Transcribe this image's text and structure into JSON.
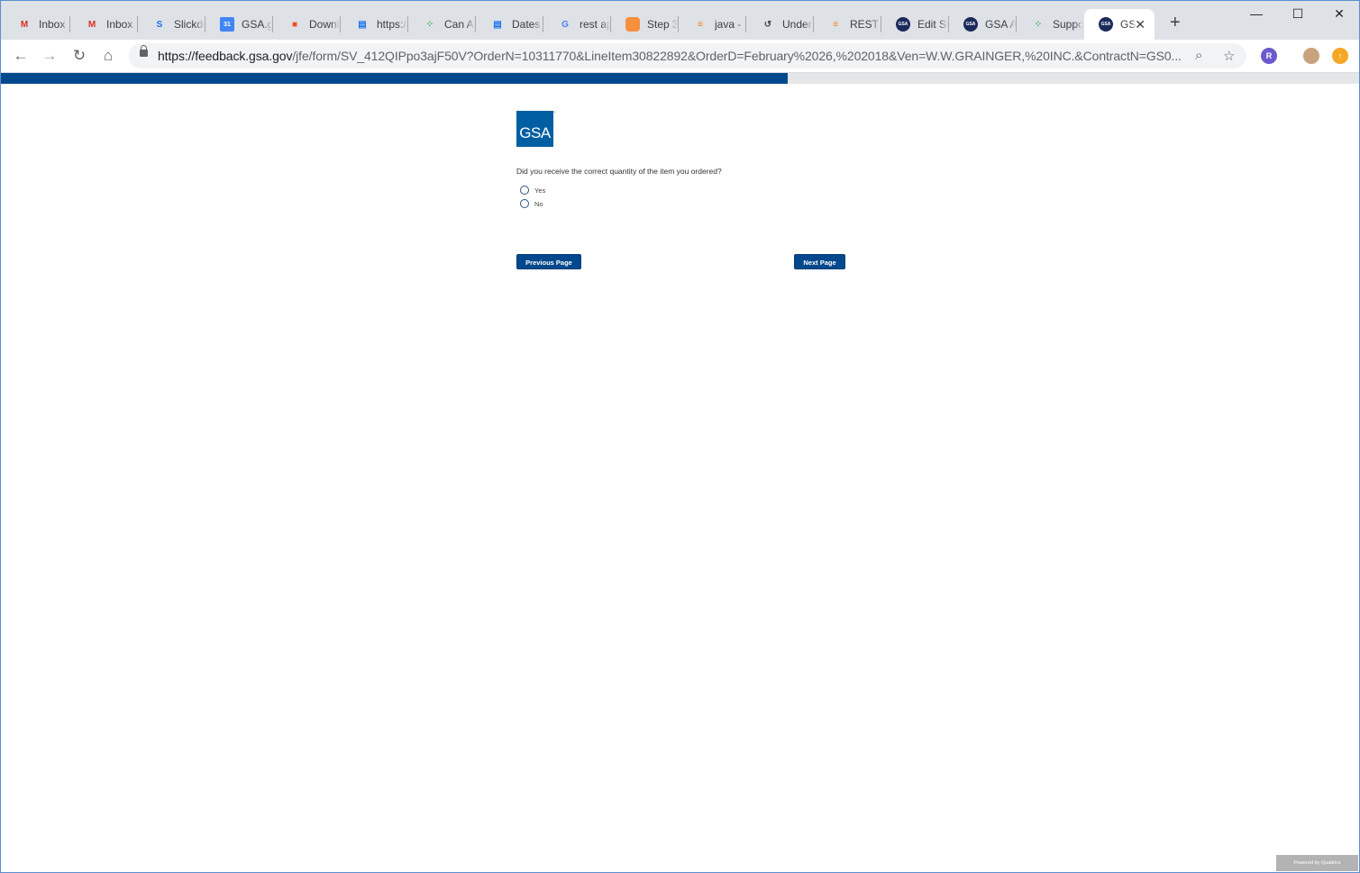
{
  "browser": {
    "tabs": [
      {
        "label": "Inbox",
        "icon": "gmail-icon",
        "color": "#d93025",
        "glyph": "M"
      },
      {
        "label": "Inbox",
        "icon": "gmail-icon",
        "color": "#d93025",
        "glyph": "M"
      },
      {
        "label": "Slickde",
        "icon": "slickdeals-icon",
        "color": "#1a73e8",
        "glyph": "S"
      },
      {
        "label": "GSA.g",
        "icon": "calendar-icon",
        "color": "#4285f4",
        "glyph": "31"
      },
      {
        "label": "Downl",
        "icon": "microsoft-icon",
        "color": "#f25022",
        "glyph": "■"
      },
      {
        "label": "https:/",
        "icon": "reader-icon",
        "color": "#1a73e8",
        "glyph": "▤"
      },
      {
        "label": "Can Al",
        "icon": "dots-icon",
        "color": "#34a853",
        "glyph": "⁘"
      },
      {
        "label": "Dates",
        "icon": "reader-icon",
        "color": "#1a73e8",
        "glyph": "▤"
      },
      {
        "label": "rest ap",
        "icon": "google-icon",
        "color": "#4285f4",
        "glyph": "G"
      },
      {
        "label": "Step 3",
        "icon": "orange-square-icon",
        "color": "#f5903d",
        "glyph": ""
      },
      {
        "label": "java - ",
        "icon": "stackoverflow-icon",
        "color": "#f48024",
        "glyph": "≡"
      },
      {
        "label": "Under",
        "icon": "swirl-icon",
        "color": "#444444",
        "glyph": "↺"
      },
      {
        "label": "REST A",
        "icon": "stackoverflow-icon",
        "color": "#f48024",
        "glyph": "≡"
      },
      {
        "label": "Edit Su",
        "icon": "gsa-seal-icon",
        "color": "#1c2a5b",
        "glyph": "GSA"
      },
      {
        "label": "GSA A",
        "icon": "gsa-seal-icon",
        "color": "#1c2a5b",
        "glyph": "GSA"
      },
      {
        "label": "Suppo",
        "icon": "dots-icon",
        "color": "#34a853",
        "glyph": "⁘"
      },
      {
        "label": "GS",
        "icon": "gsa-seal-icon",
        "color": "#1c2a5b",
        "glyph": "GSA"
      }
    ],
    "new_tab": "+",
    "close_tab": "✕",
    "minimize": "—",
    "maximize": "☐",
    "close_window": "✕",
    "url_host": "https://feedback.gsa.gov",
    "url_rest": "/jfe/form/SV_412QIPpo3ajF50V?OrderN=10311770&LineItem30822892&OrderD=February%2026,%202018&Ven=W.W.GRAINGER,%20INC.&ContractN=GS0..."
  },
  "survey": {
    "progress_fraction": 0.579,
    "logo_text": "GSA",
    "logo_mark": "®",
    "question": "Did you receive the correct quantity of the item you ordered?",
    "choices": [
      "Yes",
      "No"
    ],
    "previous_label": "Previous Page",
    "next_label": "Next Page",
    "powered_by": "Powered by Qualtrics",
    "colors": {
      "accent": "#02488c",
      "logo": "#005ea2"
    }
  }
}
